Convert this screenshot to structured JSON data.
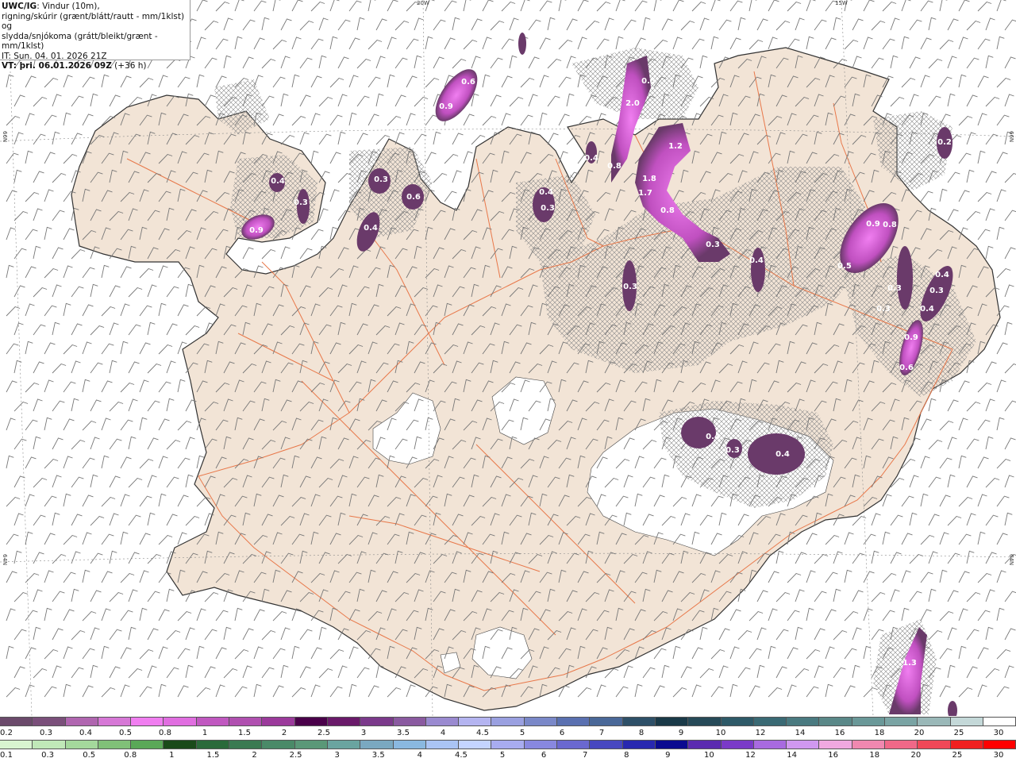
{
  "legend": {
    "title_bold": "UWC/IG",
    "title_rest": ": Vindur (10m),",
    "line2": "rigning/skúrir (grænt/blátt/rautt - mm/1klst) og",
    "line3": "slydda/snjókoma (grátt/bleikt/grænt - mm/1klst)",
    "line4": "IT: Sun. 04. 01. 2026 21Z",
    "line5_bold": "VT: þri. 06.01.2026 09Z",
    "line5_rest": " (+36 h)"
  },
  "grid_labels": {
    "lon_20w": "20W",
    "lon_15w": "15W",
    "lat_66n_left": "66N",
    "lat_66n_right": "66N",
    "lat_64n_left": "64N",
    "lat_64n_right": "64N"
  },
  "precip_labels": [
    {
      "v": "0.5"
    },
    {
      "v": "0.6"
    },
    {
      "v": "0.9"
    },
    {
      "v": "2.0"
    },
    {
      "v": "1.2"
    },
    {
      "v": "0.4"
    },
    {
      "v": "0.3"
    },
    {
      "v": "0.6"
    },
    {
      "v": "0.8"
    },
    {
      "v": "1.8"
    },
    {
      "v": "1.7"
    },
    {
      "v": "0.8"
    },
    {
      "v": "0.3"
    },
    {
      "v": "0.4"
    },
    {
      "v": "0.3"
    },
    {
      "v": "0.4"
    },
    {
      "v": "0.3"
    },
    {
      "v": "0.9"
    },
    {
      "v": "0.8"
    },
    {
      "v": "0.5"
    },
    {
      "v": "0.4"
    },
    {
      "v": "0.3"
    },
    {
      "v": "0.3"
    },
    {
      "v": "0.4"
    },
    {
      "v": "0.3"
    },
    {
      "v": "0.4"
    },
    {
      "v": "0.9"
    },
    {
      "v": "0.6"
    },
    {
      "v": "0.4"
    },
    {
      "v": "0.3"
    },
    {
      "v": "0.4"
    },
    {
      "v": "0.3"
    },
    {
      "v": "0.2"
    },
    {
      "v": "1.3"
    }
  ],
  "scale_top": {
    "colors": [
      "#6b4a6b",
      "#7a4f7a",
      "#b066b0",
      "#d678d6",
      "#f07ef0",
      "#e06ee0",
      "#c058c0",
      "#b050b0",
      "#9b3a9b",
      "#4a004a",
      "#6a1a6a",
      "#7b3a8b",
      "#8a5aa0",
      "#9a8ad0",
      "#b4b4f0",
      "#9aa0e0",
      "#7a88c8",
      "#5a70b0",
      "#4a6898",
      "#2e5068",
      "#1a3a48",
      "#264a58",
      "#2e5a68",
      "#3a6a74",
      "#4a7a80",
      "#5a8888",
      "#6a9898",
      "#7aa4a4",
      "#9ab8b8",
      "#c4d8d8",
      "#ffffff"
    ],
    "labels": [
      "0.2",
      "0.3",
      "0.4",
      "0.5",
      "0.8",
      "1",
      "1.5",
      "2",
      "2.5",
      "3",
      "3.5",
      "4",
      "4.5",
      "5",
      "6",
      "7",
      "8",
      "9",
      "10",
      "12",
      "14",
      "16",
      "18",
      "20",
      "25",
      "30"
    ]
  },
  "scale_bottom": {
    "colors": [
      "#d8f4d0",
      "#c0e8b8",
      "#a4d89c",
      "#80c078",
      "#5aa858",
      "#1a4a1a",
      "#2a6a3a",
      "#3a7a52",
      "#4a8a68",
      "#5a9878",
      "#6aa4a0",
      "#7aa8c0",
      "#8ab8e0",
      "#aac4f4",
      "#c4d4ff",
      "#a8acf0",
      "#8888e0",
      "#6a68d0",
      "#4848c0",
      "#2828b0",
      "#0a0a90",
      "#5a2ab0",
      "#7a3ac8",
      "#a86ae0",
      "#d098f0",
      "#f0a8e0",
      "#f088b0",
      "#f06888",
      "#f04858",
      "#f02020",
      "#ff0000"
    ],
    "labels": [
      "0.1",
      "0.3",
      "0.5",
      "0.8",
      "1",
      "1.5",
      "2",
      "2.5",
      "3",
      "3.5",
      "4",
      "4.5",
      "5",
      "6",
      "7",
      "8",
      "9",
      "10",
      "12",
      "14",
      "16",
      "18",
      "20",
      "25",
      "30"
    ]
  },
  "colors": {
    "land": "#f2e4d6",
    "roads": "#e8784a",
    "snow_light": "#e060e0",
    "snow_medium": "#c040c0",
    "snow_dark": "#6a3a6a",
    "wind_barb": "#777777"
  }
}
